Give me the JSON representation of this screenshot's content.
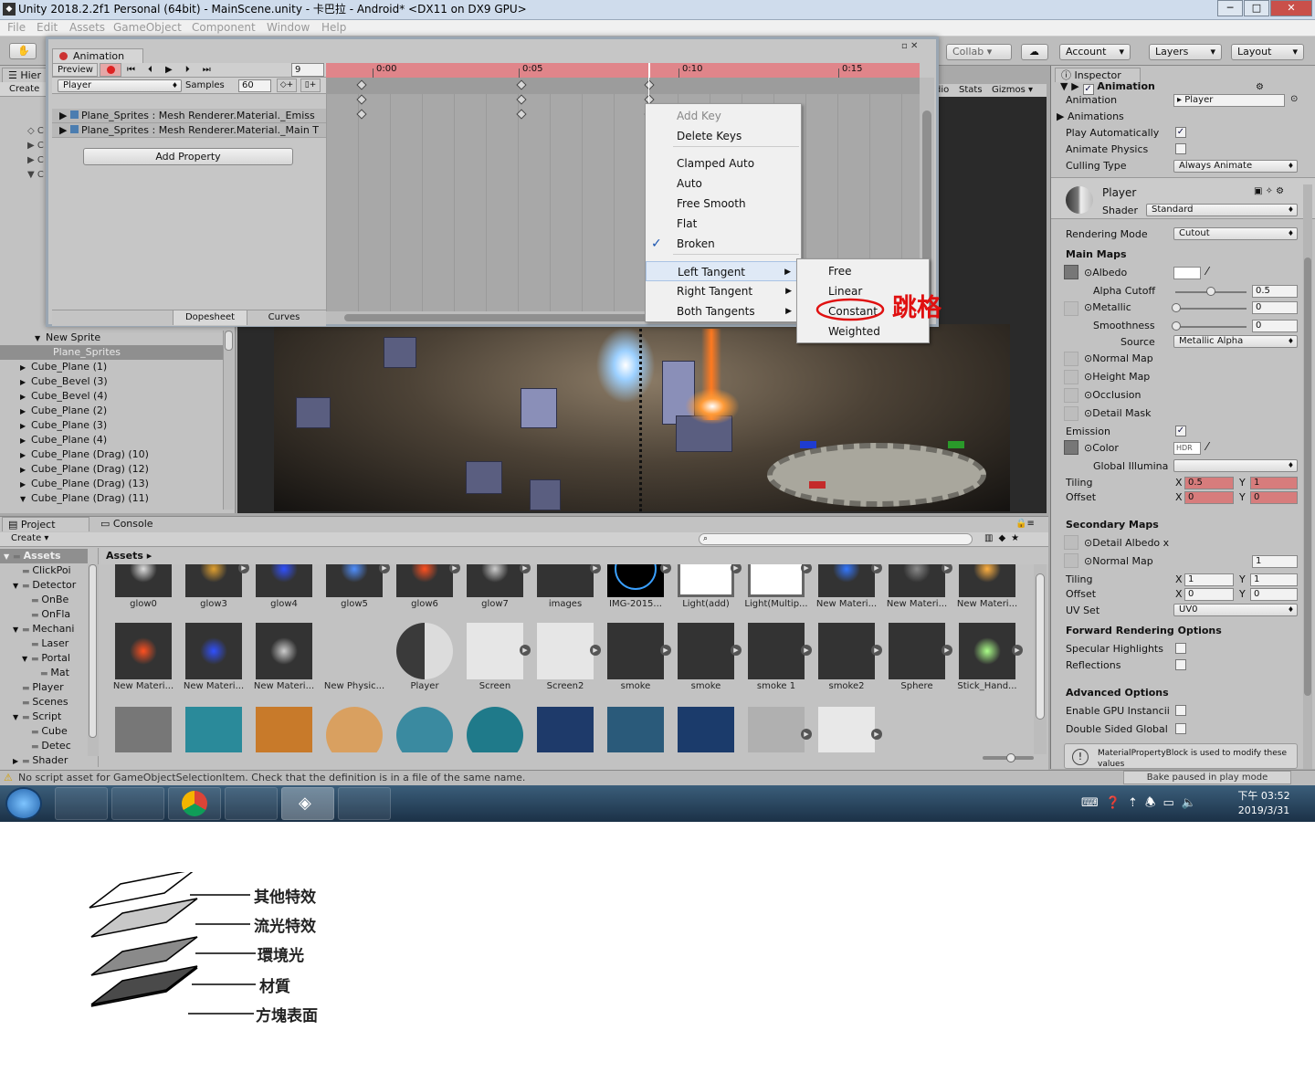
{
  "window": {
    "title": "Unity 2018.2.2f1 Personal (64bit) - MainScene.unity - 卡巴拉 - Android* <DX11 on DX9 GPU>",
    "min": "─",
    "max": "□",
    "close": "✕"
  },
  "menu": [
    "File",
    "Edit",
    "Assets",
    "GameObject",
    "Component",
    "Window",
    "Help"
  ],
  "toolbar": {
    "collab": "Collab ▾",
    "account": "Account",
    "layers": "Layers",
    "layout": "Layout"
  },
  "hierarchy": {
    "tab": "Hier",
    "create": "Create",
    "items": [
      {
        "label": "New Sprite",
        "indent": 4,
        "arrow": "▼"
      },
      {
        "label": "Plane_Sprites",
        "indent": 5,
        "arrow": "",
        "selected": true
      },
      {
        "label": "Cube_Plane (1)",
        "indent": 2,
        "arrow": "▶"
      },
      {
        "label": "Cube_Bevel (3)",
        "indent": 2,
        "arrow": "▶"
      },
      {
        "label": "Cube_Bevel (4)",
        "indent": 2,
        "arrow": "▶"
      },
      {
        "label": "Cube_Plane (2)",
        "indent": 2,
        "arrow": "▶"
      },
      {
        "label": "Cube_Plane (3)",
        "indent": 2,
        "arrow": "▶"
      },
      {
        "label": "Cube_Plane (4)",
        "indent": 2,
        "arrow": "▶"
      },
      {
        "label": "Cube_Plane (Drag) (10)",
        "indent": 2,
        "arrow": "▶"
      },
      {
        "label": "Cube_Plane (Drag) (12)",
        "indent": 2,
        "arrow": "▶"
      },
      {
        "label": "Cube_Plane (Drag) (13)",
        "indent": 2,
        "arrow": "▶"
      },
      {
        "label": "Cube_Plane (Drag) (11)",
        "indent": 2,
        "arrow": "▼"
      }
    ]
  },
  "scene": {
    "tabs": [
      "dio",
      "Stats",
      "Gizmos ▾"
    ]
  },
  "animation": {
    "title": "Animation",
    "preview": "Preview",
    "frame": "9",
    "clip": "Player",
    "samples_label": "Samples",
    "samples": "60",
    "times": [
      "0:00",
      "0:05",
      "0:10",
      "0:15"
    ],
    "properties": [
      "Plane_Sprites : Mesh Renderer.Material._Emiss",
      "Plane_Sprites : Mesh Renderer.Material._Main T"
    ],
    "add_property": "Add Property",
    "tab_dopesheet": "Dopesheet",
    "tab_curves": "Curves"
  },
  "context_menu": {
    "items": [
      "Add Key",
      "Delete Keys",
      "Clamped Auto",
      "Auto",
      "Free Smooth",
      "Flat",
      "Broken",
      "Left Tangent",
      "Right Tangent",
      "Both Tangents"
    ],
    "checked": "Broken",
    "check_mark": "✓",
    "sub_arrow": "▶",
    "submenu": [
      "Free",
      "Linear",
      "Constant",
      "Weighted"
    ]
  },
  "annotation": {
    "text": "跳格",
    "color": "#e01010"
  },
  "inspector": {
    "tab": "Inspector",
    "animator_header": "Animation",
    "rows": {
      "animation_label": "Animation",
      "animation_value": "Player",
      "animations": "Animations",
      "play_auto": "Play Automatically",
      "animate_physics": "Animate Physics",
      "culling_type": "Culling Type",
      "culling_value": "Always Animate"
    },
    "material": {
      "name": "Player",
      "shader_label": "Shader",
      "shader": "Standard",
      "rendering_mode_label": "Rendering Mode",
      "rendering_mode": "Cutout",
      "main_maps": "Main Maps",
      "albedo": "Albedo",
      "alpha_cutoff": "Alpha Cutoff",
      "alpha_cutoff_value": "0.5",
      "metallic": "Metallic",
      "metallic_value": "0",
      "smoothness": "Smoothness",
      "smoothness_value": "0",
      "source": "Source",
      "source_value": "Metallic Alpha",
      "normal_map": "Normal Map",
      "height_map": "Height Map",
      "occlusion": "Occlusion",
      "detail_mask": "Detail Mask",
      "emission": "Emission",
      "color": "Color",
      "hdr": "HDR",
      "global_illum": "Global Illumina",
      "tiling": "Tiling",
      "offset": "Offset",
      "x": "X",
      "y": "Y",
      "tiling_x": "0.5",
      "tiling_y": "1",
      "offset_x": "0",
      "offset_y": "0",
      "secondary_maps": "Secondary Maps",
      "detail_albedo": "Detail Albedo x",
      "normal_map2": "Normal Map",
      "normal_map2_value": "1",
      "tiling2_x": "1",
      "tiling2_y": "1",
      "offset2_x": "0",
      "offset2_y": "0",
      "uv_set": "UV Set",
      "uv_set_value": "UV0",
      "forward_opts": "Forward Rendering Options",
      "specular": "Specular Highlights",
      "reflections": "Reflections",
      "advanced": "Advanced Options",
      "gpu_instancing": "Enable GPU Instancii",
      "double_sided": "Double Sided Global",
      "help": "MaterialPropertyBlock is used to modify these values",
      "bake": "Bake paused in play mode"
    }
  },
  "project": {
    "tab_project": "Project",
    "tab_console": "Console",
    "create": "Create ▾",
    "breadcrumb": "Assets ▸",
    "tree": [
      {
        "label": "Assets",
        "indent": 0,
        "arrow": "▼",
        "bold": true
      },
      {
        "label": "ClickPoi",
        "indent": 1,
        "arrow": ""
      },
      {
        "label": "Detector",
        "indent": 1,
        "arrow": "▼"
      },
      {
        "label": "OnBe",
        "indent": 2,
        "arrow": ""
      },
      {
        "label": "OnFla",
        "indent": 2,
        "arrow": ""
      },
      {
        "label": "Mechani",
        "indent": 1,
        "arrow": "▼"
      },
      {
        "label": "Laser",
        "indent": 2,
        "arrow": ""
      },
      {
        "label": "Portal",
        "indent": 2,
        "arrow": "▼"
      },
      {
        "label": "Mat",
        "indent": 3,
        "arrow": ""
      },
      {
        "label": "Player",
        "indent": 1,
        "arrow": ""
      },
      {
        "label": "Scenes",
        "indent": 1,
        "arrow": ""
      },
      {
        "label": "Script",
        "indent": 1,
        "arrow": "▼"
      },
      {
        "label": "Cube",
        "indent": 2,
        "arrow": ""
      },
      {
        "label": "Detec",
        "indent": 2,
        "arrow": ""
      },
      {
        "label": "Shader",
        "indent": 1,
        "arrow": "▶"
      }
    ],
    "row1": [
      "glow0",
      "glow3",
      "glow4",
      "glow5",
      "glow6",
      "glow7",
      "images",
      "IMG-2015...",
      "Light(add)",
      "Light(Multip...",
      "New Materi...",
      "New Materi...",
      "New Materi..."
    ],
    "row2": [
      "New Materi...",
      "New Materi...",
      "New Materi...",
      "New Physic...",
      "Player",
      "Screen",
      "Screen2",
      "smoke",
      "smoke",
      "smoke 1",
      "smoke2",
      "Sphere",
      "Stick_Hand..."
    ]
  },
  "status": {
    "message": "No script asset for GameObjectSelectionItem. Check that the definition is in a file of the same name."
  },
  "taskbar": {
    "time": "下午 03:52",
    "date": "2019/3/31"
  },
  "diagram": {
    "layers": [
      "其他特效",
      "流光特效",
      "環境光",
      "材質",
      "方塊表面"
    ]
  }
}
